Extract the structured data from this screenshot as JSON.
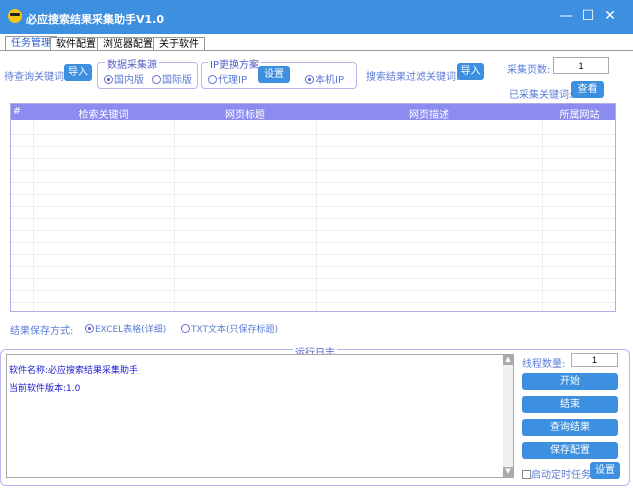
{
  "window": {
    "title": "必应搜索结果采集助手V1.0",
    "icon": "sunglasses-emoji-icon",
    "accent": "#3d8fe0"
  },
  "tabs": [
    {
      "label": "任务管理",
      "active": true
    },
    {
      "label": "软件配置"
    },
    {
      "label": "浏览器配置"
    },
    {
      "label": "关于软件"
    }
  ],
  "keywords": {
    "label": "待查询关键词:",
    "import": "导入"
  },
  "source": {
    "legend": "数据采集源",
    "options": [
      "国内版",
      "国际版"
    ],
    "selected": "国内版"
  },
  "ip": {
    "legend": "IP更换方案",
    "proxy": "代理IP",
    "settings": "设置",
    "local": "本机IP",
    "selected": "本机IP"
  },
  "filter": {
    "label": "搜索结果过滤关键词:",
    "import": "导入"
  },
  "pages": {
    "label": "采集页数:",
    "value": "1"
  },
  "collected": {
    "label": "已采集关键词:",
    "view": "查看"
  },
  "table": {
    "headers": [
      "#",
      "检索关键词",
      "网页标题",
      "网页描述",
      "所属网站"
    ],
    "rows": []
  },
  "save": {
    "label": "结果保存方式:",
    "excel": "EXCEL表格(详细)",
    "txt": "TXT文本(只保存标题)",
    "selected": "excel"
  },
  "log": {
    "legend": "运行日志",
    "lines": [
      "软件名称:必应搜索结果采集助手",
      "当前软件版本:1.0"
    ]
  },
  "threads": {
    "label": "线程数量:",
    "value": "1"
  },
  "buttons": {
    "start": "开始",
    "stop": "结束",
    "query": "查询结果",
    "save_config": "保存配置"
  },
  "timer": {
    "label": "启动定时任务",
    "checked": false,
    "settings": "设置"
  }
}
